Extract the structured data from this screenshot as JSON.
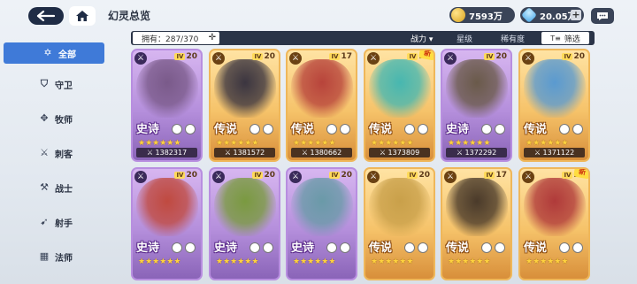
{
  "header": {
    "title": "幻灵总览",
    "gold": "7593万",
    "diamond": "20.05万"
  },
  "sidebar": {
    "items": [
      {
        "label": "全部",
        "icon": "star-of-david-icon",
        "active": true
      },
      {
        "label": "守卫",
        "icon": "shield-icon",
        "active": false
      },
      {
        "label": "牧师",
        "icon": "wings-icon",
        "active": false
      },
      {
        "label": "刺客",
        "icon": "dagger-icon",
        "active": false
      },
      {
        "label": "战士",
        "icon": "axe-icon",
        "active": false
      },
      {
        "label": "射手",
        "icon": "bow-icon",
        "active": false
      },
      {
        "label": "法师",
        "icon": "book-icon",
        "active": false
      }
    ]
  },
  "filter": {
    "owned": "拥有：287/370",
    "power": "战力 ▾",
    "star": "星级",
    "rarity": "稀有度",
    "filter_button": "筛选"
  },
  "cards": [
    {
      "level": "20",
      "rarity": "史诗",
      "power": "1382317",
      "stars": "★★★★★★",
      "style": "purple",
      "portrait": "#7a5a8a",
      "new": false
    },
    {
      "level": "20",
      "rarity": "传说",
      "power": "1381572",
      "stars": "★★★★★★",
      "style": "gold",
      "portrait": "#3b3540",
      "new": false
    },
    {
      "level": "17",
      "rarity": "传说",
      "power": "1380662",
      "stars": "★★★★★★",
      "style": "gold",
      "portrait": "#b8443b",
      "new": false
    },
    {
      "level": "20",
      "rarity": "传说",
      "power": "1373809",
      "stars": "★★★★★★",
      "style": "gold",
      "portrait": "#47b7b0",
      "new": true
    },
    {
      "level": "20",
      "rarity": "史诗",
      "power": "1372292",
      "stars": "★★★★★★",
      "style": "purple",
      "portrait": "#6a5a4a",
      "new": false
    },
    {
      "level": "20",
      "rarity": "传说",
      "power": "1371122",
      "stars": "★★★★★★",
      "style": "gold",
      "portrait": "#5a9ad0",
      "new": false
    },
    {
      "level": "20",
      "rarity": "史诗",
      "power": "",
      "stars": "★★★★★★",
      "style": "purple",
      "portrait": "#c04a40",
      "new": false
    },
    {
      "level": "20",
      "rarity": "史诗",
      "power": "",
      "stars": "★★★★★★",
      "style": "purple",
      "portrait": "#7a9a40",
      "new": false
    },
    {
      "level": "20",
      "rarity": "史诗",
      "power": "",
      "stars": "★★★★★★",
      "style": "purple",
      "portrait": "#6a9aa8",
      "new": false
    },
    {
      "level": "20",
      "rarity": "传说",
      "power": "",
      "stars": "★★★★★★",
      "style": "gold",
      "portrait": "#c9a04a",
      "new": false
    },
    {
      "level": "17",
      "rarity": "传说",
      "power": "",
      "stars": "★★★★★★",
      "style": "gold",
      "portrait": "#4a3a2a",
      "new": false
    },
    {
      "level": "20",
      "rarity": "传说",
      "power": "",
      "stars": "★★★★★★",
      "style": "gold",
      "portrait": "#b03a3a",
      "new": true
    }
  ]
}
